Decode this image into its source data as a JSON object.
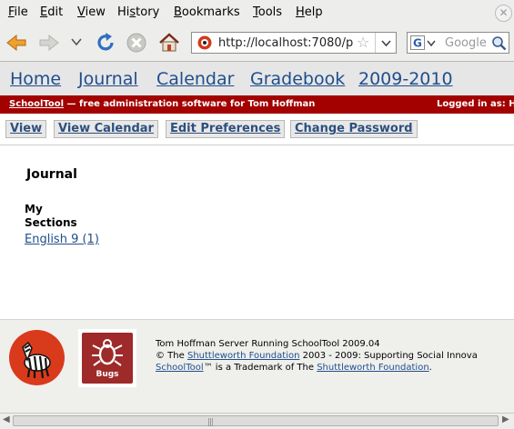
{
  "menu": {
    "file": {
      "u": "F",
      "rest": "ile"
    },
    "edit": {
      "u": "E",
      "rest": "dit"
    },
    "view": {
      "u": "V",
      "rest": "iew"
    },
    "history": {
      "pre": "Hi",
      "u": "s",
      "rest": "tory"
    },
    "bookmarks": {
      "u": "B",
      "rest": "ookmarks"
    },
    "tools": {
      "u": "T",
      "rest": "ools"
    },
    "help": {
      "u": "H",
      "rest": "elp"
    }
  },
  "toolbar": {
    "url": "http://localhost:7080/p",
    "search_placeholder": "Google"
  },
  "nav": {
    "items": [
      "Home",
      "Journal",
      "Calendar",
      "Gradebook",
      "2009-2010"
    ]
  },
  "banner": {
    "brand": "SchoolTool",
    "tagline": " — free administration software for Tom Hoffman",
    "logged_in": "Logged in as: H"
  },
  "actions": [
    "View",
    "View Calendar",
    "Edit Preferences",
    "Change Password"
  ],
  "content": {
    "title": "Journal",
    "section_head_1": "My",
    "section_head_2": "Sections",
    "section_link": "English 9 (1)"
  },
  "footer": {
    "bugs_label": "Bugs",
    "line1": "Tom Hoffman Server Running SchoolTool 2009.04",
    "line2_a": "© The ",
    "line2_link": "Shuttleworth Foundation",
    "line2_b": " 2003 - 2009: Supporting Social Innova",
    "line3_link1": "SchoolTool",
    "line3_mid": "™ is a Trademark of The ",
    "line3_link2": "Shuttleworth Foundation",
    "line3_end": "."
  },
  "colors": {
    "nav_link": "#1f4e8c",
    "banner_bg": "#a30000",
    "footer_bg": "#efefec"
  }
}
